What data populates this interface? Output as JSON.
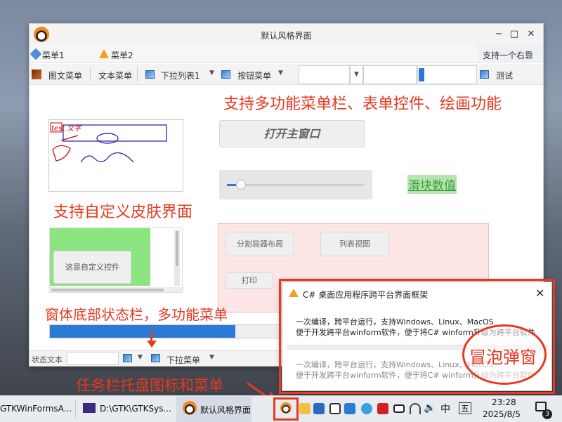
{
  "window": {
    "title": "默认风格界面",
    "minimize_glyph": "−",
    "maximize_glyph": "□",
    "close_glyph": "✕"
  },
  "menubar": {
    "items": [
      "菜单1",
      "菜单2"
    ],
    "right_text": "支持一个右靠"
  },
  "toolbar": {
    "image_menu": "图文菜单",
    "text_menu": "文本菜单",
    "dropdown_list": "下拉列表1",
    "button_menu": "按钮菜单",
    "test_label": "测试",
    "progress_fraction": 0.1
  },
  "content": {
    "heading_features": "支持多功能菜单栏、表单控件、绘画功能",
    "open_main_button": "打开主窗口",
    "slider_value_label": "滑块数值",
    "slider_fraction": 0.1,
    "drawing_text": "test 文字",
    "heading_skin": "支持自定义皮肤界面",
    "custom_control": "这是自定义控件",
    "split_button": "分割容器布局",
    "listview_button": "列表视图",
    "print_button": "打印",
    "heading_statusbar": "窗体底部状态栏，多功能菜单",
    "status_progress_fraction": 0.78
  },
  "statusbar": {
    "text": "状态文本",
    "dropdown_menu": "下拉菜单"
  },
  "annotations": {
    "tray_caption": "任务栏托盘图标和菜单",
    "bubble_caption": "冒泡弹窗"
  },
  "notification": {
    "title": "C# 桌面应用程序跨平台界面框架",
    "line1": "一次编译，跨平台运行，支持Windows、Linux、MacOS",
    "line2": "便于开发跨平台winform软件，便于将C# winform升级为跨平台软件",
    "line3": "一次编译，跨平台运行，支持Windows、Linux、MacOS",
    "line4": "便于开发跨平台winform软件，便于将C# winform升级为跨平台软件"
  },
  "taskbar": {
    "app1": "GTKWinFormsA...",
    "app2": "D:\\GTK\\GTKSys...",
    "app3": "默认风格界面",
    "ime_lang": "中",
    "ime_mode": "五",
    "time": "23:28",
    "date": "2025/8/5",
    "notification_count": "3"
  },
  "colors": {
    "accent_red": "#e8381f",
    "progress_blue": "#2a7ad6",
    "slider_label_bg": "#b7e3b0",
    "custom_green": "#8be47f"
  }
}
